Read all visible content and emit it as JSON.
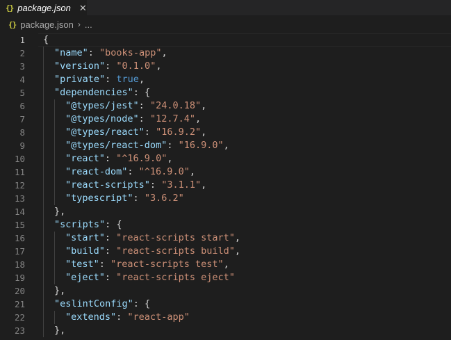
{
  "tab": {
    "icon_text": "{}",
    "icon_name": "json-icon",
    "label": "package.json",
    "close_glyph": "✕"
  },
  "breadcrumb": {
    "icon_text": "{}",
    "file": "package.json",
    "separator": "›",
    "rest": "..."
  },
  "colors": {
    "background": "#1e1e1e",
    "key": "#9cdcfe",
    "string": "#ce9178",
    "boolean": "#569cd6",
    "punctuation": "#d4d4d4",
    "line_number": "#858585"
  },
  "lines": [
    {
      "n": "1",
      "indent": 0,
      "tokens": [
        [
          "p",
          "{"
        ]
      ]
    },
    {
      "n": "2",
      "indent": 1,
      "tokens": [
        [
          "k",
          "\"name\""
        ],
        [
          "p",
          ": "
        ],
        [
          "s",
          "\"books-app\""
        ],
        [
          "p",
          ","
        ]
      ]
    },
    {
      "n": "3",
      "indent": 1,
      "tokens": [
        [
          "k",
          "\"version\""
        ],
        [
          "p",
          ": "
        ],
        [
          "s",
          "\"0.1.0\""
        ],
        [
          "p",
          ","
        ]
      ]
    },
    {
      "n": "4",
      "indent": 1,
      "tokens": [
        [
          "k",
          "\"private\""
        ],
        [
          "p",
          ": "
        ],
        [
          "b",
          "true"
        ],
        [
          "p",
          ","
        ]
      ]
    },
    {
      "n": "5",
      "indent": 1,
      "tokens": [
        [
          "k",
          "\"dependencies\""
        ],
        [
          "p",
          ": {"
        ]
      ]
    },
    {
      "n": "6",
      "indent": 2,
      "tokens": [
        [
          "k",
          "\"@types/jest\""
        ],
        [
          "p",
          ": "
        ],
        [
          "s",
          "\"24.0.18\""
        ],
        [
          "p",
          ","
        ]
      ]
    },
    {
      "n": "7",
      "indent": 2,
      "tokens": [
        [
          "k",
          "\"@types/node\""
        ],
        [
          "p",
          ": "
        ],
        [
          "s",
          "\"12.7.4\""
        ],
        [
          "p",
          ","
        ]
      ]
    },
    {
      "n": "8",
      "indent": 2,
      "tokens": [
        [
          "k",
          "\"@types/react\""
        ],
        [
          "p",
          ": "
        ],
        [
          "s",
          "\"16.9.2\""
        ],
        [
          "p",
          ","
        ]
      ]
    },
    {
      "n": "9",
      "indent": 2,
      "tokens": [
        [
          "k",
          "\"@types/react-dom\""
        ],
        [
          "p",
          ": "
        ],
        [
          "s",
          "\"16.9.0\""
        ],
        [
          "p",
          ","
        ]
      ]
    },
    {
      "n": "10",
      "indent": 2,
      "tokens": [
        [
          "k",
          "\"react\""
        ],
        [
          "p",
          ": "
        ],
        [
          "s",
          "\"^16.9.0\""
        ],
        [
          "p",
          ","
        ]
      ]
    },
    {
      "n": "11",
      "indent": 2,
      "tokens": [
        [
          "k",
          "\"react-dom\""
        ],
        [
          "p",
          ": "
        ],
        [
          "s",
          "\"^16.9.0\""
        ],
        [
          "p",
          ","
        ]
      ]
    },
    {
      "n": "12",
      "indent": 2,
      "tokens": [
        [
          "k",
          "\"react-scripts\""
        ],
        [
          "p",
          ": "
        ],
        [
          "s",
          "\"3.1.1\""
        ],
        [
          "p",
          ","
        ]
      ]
    },
    {
      "n": "13",
      "indent": 2,
      "tokens": [
        [
          "k",
          "\"typescript\""
        ],
        [
          "p",
          ": "
        ],
        [
          "s",
          "\"3.6.2\""
        ]
      ]
    },
    {
      "n": "14",
      "indent": 1,
      "tokens": [
        [
          "p",
          "},"
        ]
      ]
    },
    {
      "n": "15",
      "indent": 1,
      "tokens": [
        [
          "k",
          "\"scripts\""
        ],
        [
          "p",
          ": {"
        ]
      ]
    },
    {
      "n": "16",
      "indent": 2,
      "tokens": [
        [
          "k",
          "\"start\""
        ],
        [
          "p",
          ": "
        ],
        [
          "s",
          "\"react-scripts start\""
        ],
        [
          "p",
          ","
        ]
      ]
    },
    {
      "n": "17",
      "indent": 2,
      "tokens": [
        [
          "k",
          "\"build\""
        ],
        [
          "p",
          ": "
        ],
        [
          "s",
          "\"react-scripts build\""
        ],
        [
          "p",
          ","
        ]
      ]
    },
    {
      "n": "18",
      "indent": 2,
      "tokens": [
        [
          "k",
          "\"test\""
        ],
        [
          "p",
          ": "
        ],
        [
          "s",
          "\"react-scripts test\""
        ],
        [
          "p",
          ","
        ]
      ]
    },
    {
      "n": "19",
      "indent": 2,
      "tokens": [
        [
          "k",
          "\"eject\""
        ],
        [
          "p",
          ": "
        ],
        [
          "s",
          "\"react-scripts eject\""
        ]
      ]
    },
    {
      "n": "20",
      "indent": 1,
      "tokens": [
        [
          "p",
          "},"
        ]
      ]
    },
    {
      "n": "21",
      "indent": 1,
      "tokens": [
        [
          "k",
          "\"eslintConfig\""
        ],
        [
          "p",
          ": {"
        ]
      ]
    },
    {
      "n": "22",
      "indent": 2,
      "tokens": [
        [
          "k",
          "\"extends\""
        ],
        [
          "p",
          ": "
        ],
        [
          "s",
          "\"react-app\""
        ]
      ]
    },
    {
      "n": "23",
      "indent": 1,
      "tokens": [
        [
          "p",
          "},"
        ]
      ]
    }
  ]
}
